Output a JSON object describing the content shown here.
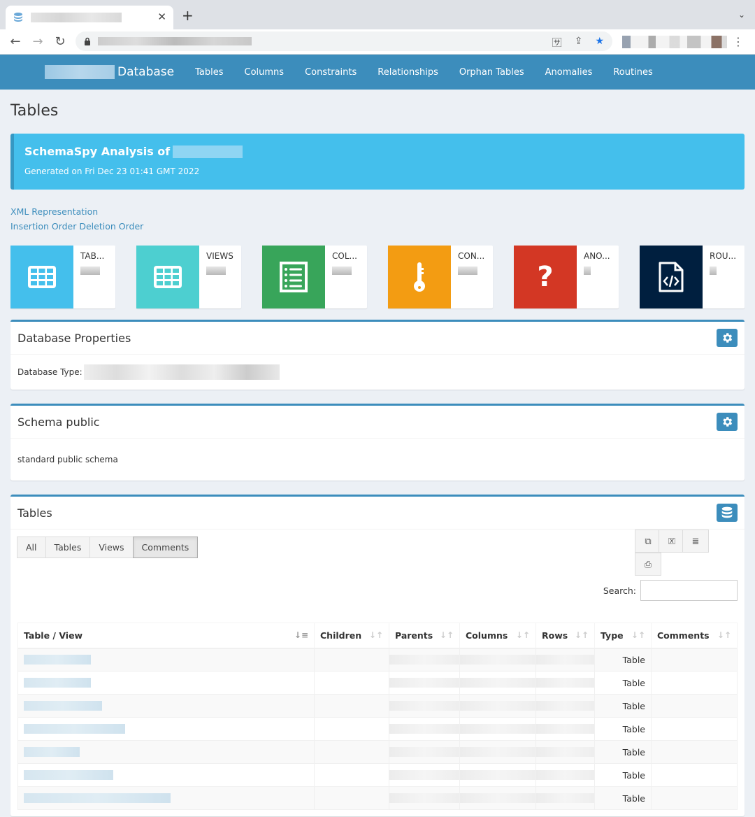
{
  "browser": {
    "tab_icon": "database-icon",
    "close_icon": "close-icon",
    "new_tab_label": "+",
    "tab_menu_icon": "chevron-down-icon",
    "back_icon": "back-icon",
    "forward_icon": "forward-icon",
    "reload_icon": "reload-icon",
    "lock_icon": "lock-icon",
    "translate_icon": "translate-icon",
    "share_icon": "share-icon",
    "bookmark_icon": "star-icon",
    "menu_icon": "kebab-icon"
  },
  "nav": {
    "brand": "Database",
    "links": [
      "Tables",
      "Columns",
      "Constraints",
      "Relationships",
      "Orphan Tables",
      "Anomalies",
      "Routines"
    ]
  },
  "page": {
    "title": "Tables",
    "callout_title": "SchemaSpy Analysis of",
    "generated": "Generated on Fri Dec 23 01:41 GMT 2022",
    "links": [
      "XML Representation",
      "Insertion Order Deletion Order"
    ]
  },
  "infoboxes": [
    {
      "label": "TAB...",
      "icon": "table-icon",
      "color": "#44bfec"
    },
    {
      "label": "VIEWS",
      "icon": "table-icon",
      "color": "#4dcfd0"
    },
    {
      "label": "COL...",
      "icon": "list-icon",
      "color": "#38a55a"
    },
    {
      "label": "CON...",
      "icon": "key-icon",
      "color": "#f39c12"
    },
    {
      "label": "ANO...",
      "icon": "question-icon",
      "color": "#d33724"
    },
    {
      "label": "ROU...",
      "icon": "code-file-icon",
      "color": "#001f3f"
    }
  ],
  "db_props": {
    "title": "Database Properties",
    "type_label": "Database Type: "
  },
  "schema": {
    "title": "Schema public",
    "description": "standard public schema"
  },
  "tables_box": {
    "title": "Tables",
    "filters": [
      "All",
      "Tables",
      "Views",
      "Comments"
    ],
    "active_filter": "Comments",
    "export_buttons": [
      "copy-icon",
      "excel-icon",
      "csv-icon",
      "pdf-icon"
    ],
    "search_label": "Search:",
    "search_value": "",
    "columns": [
      "Table / View",
      "Children",
      "Parents",
      "Columns",
      "Rows",
      "Type",
      "Comments"
    ],
    "rows": [
      {
        "type": "Table"
      },
      {
        "type": "Table"
      },
      {
        "type": "Table"
      },
      {
        "type": "Table"
      },
      {
        "type": "Table"
      },
      {
        "type": "Table"
      },
      {
        "type": "Table"
      }
    ]
  },
  "colors": {
    "primary": "#3c8dbc",
    "callout": "#44bfec"
  }
}
